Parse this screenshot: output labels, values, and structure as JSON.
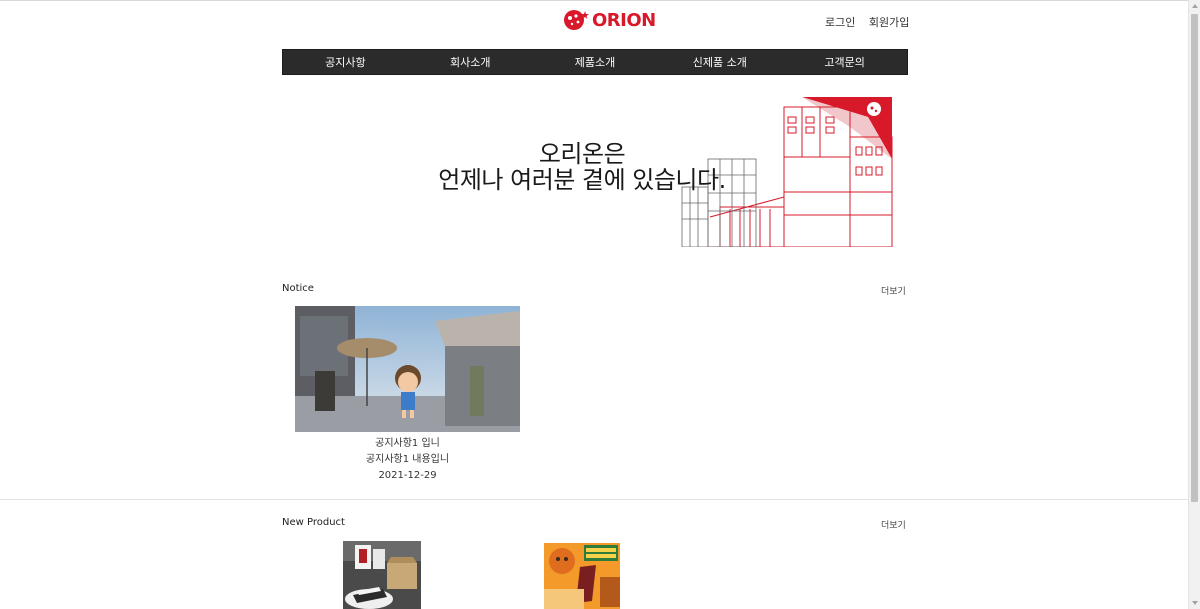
{
  "brand": {
    "logo_text": "ORION",
    "color": "#d8192a"
  },
  "auth": {
    "login": "로그인",
    "signup": "회원가입"
  },
  "nav": {
    "items": [
      "공지사항",
      "회사소개",
      "제품소개",
      "신제품 소개",
      "고객문의"
    ]
  },
  "hero": {
    "line1": "오리온은",
    "line2": "언제나 여러분 곁에 있습니다."
  },
  "notice": {
    "section_title": "Notice",
    "more_label": "더보기",
    "card": {
      "title": "공지사항1 입니",
      "body": "공지사항1 내용입니",
      "date": "2021-12-29"
    }
  },
  "new_product": {
    "section_title": "New Product",
    "more_label": "더보기"
  }
}
